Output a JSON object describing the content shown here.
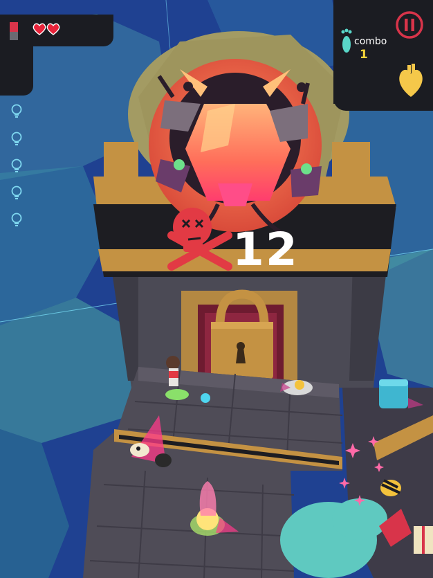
{
  "hud": {
    "lives": 2,
    "combo_label": "combo",
    "combo_value": "1",
    "pause_label": "pause",
    "hints_remaining": 5
  },
  "boss": {
    "score": "12"
  },
  "colors": {
    "hud_bg": "#1b1c22",
    "heart": "#e8233a",
    "combo_value": "#f5d43a",
    "pause": "#d8344a",
    "skull": "#e23a44",
    "teal": "#2f9aa0"
  }
}
